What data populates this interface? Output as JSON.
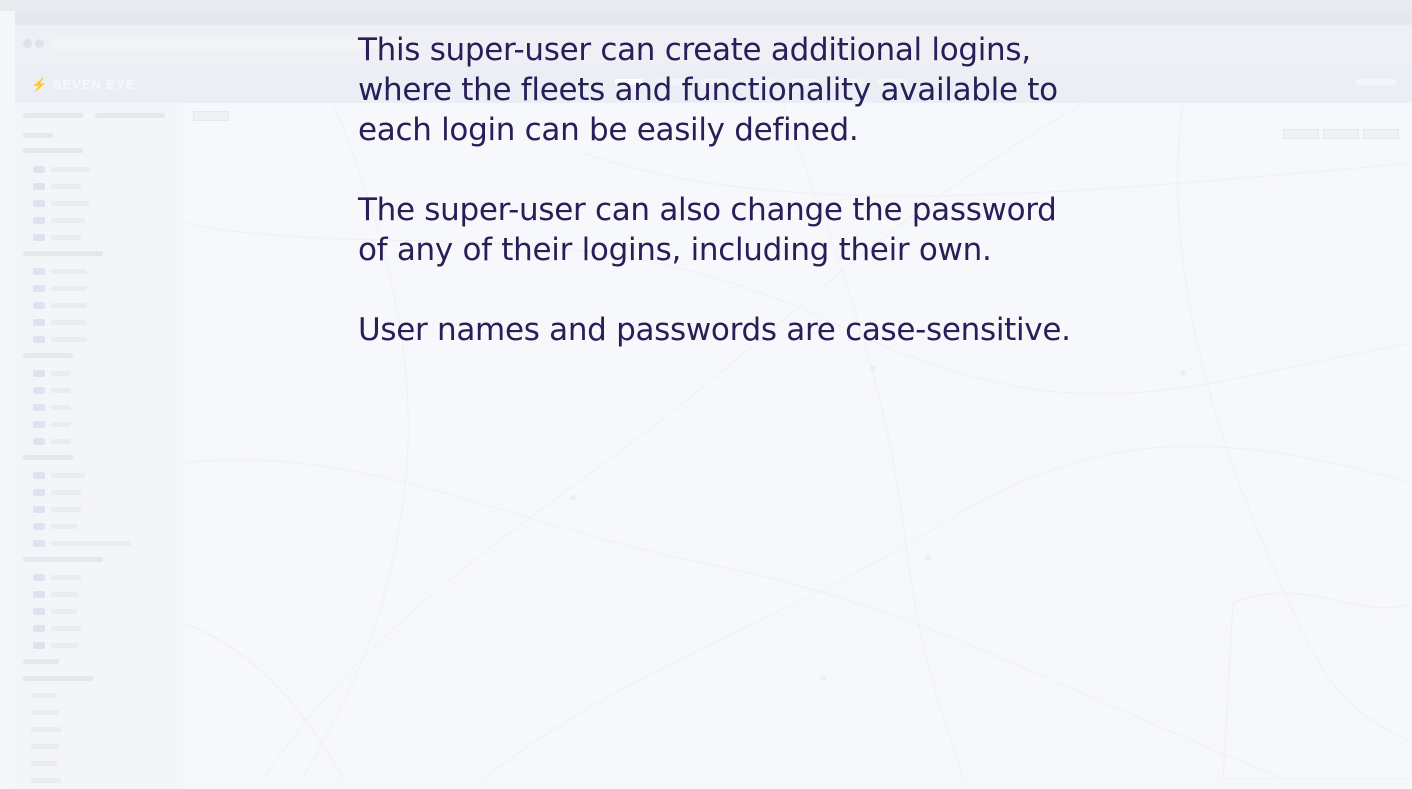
{
  "overlay": {
    "paragraphs": [
      {
        "lines": [
          "This super-user can create additional logins,",
          "where the fleets and functionality available to",
          "each login can be easily defined."
        ]
      },
      {
        "lines": [
          "The super-user can also change the password",
          "of any of their logins, including their own."
        ]
      },
      {
        "lines": [
          "User names and passwords are case-sensitive."
        ]
      }
    ],
    "text_color": "#281e58"
  },
  "background_app": {
    "brand": "SEVEN EYE",
    "logo_icon": "bolt-icon",
    "background_color": "#f6f7fb"
  }
}
